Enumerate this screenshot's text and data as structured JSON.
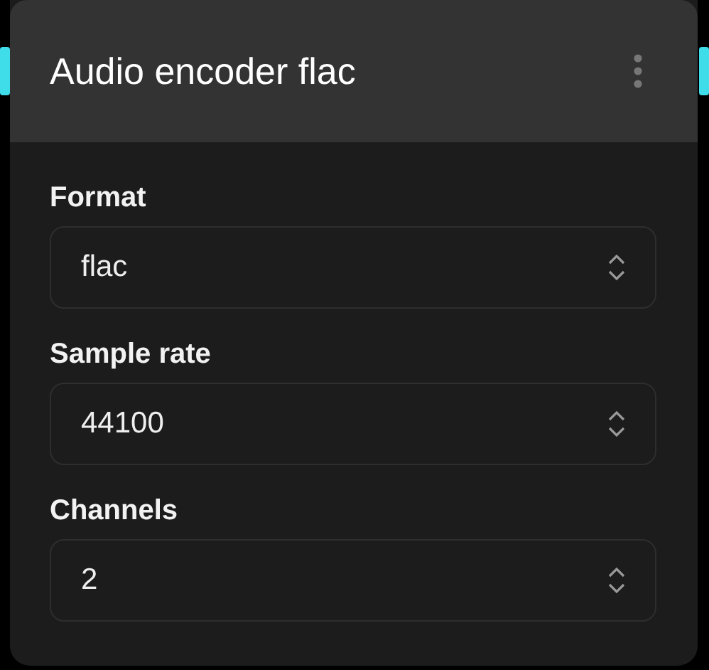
{
  "node": {
    "title": "Audio encoder flac"
  },
  "fields": [
    {
      "label": "Format",
      "value": "flac"
    },
    {
      "label": "Sample rate",
      "value": "44100"
    },
    {
      "label": "Channels",
      "value": "2"
    }
  ]
}
